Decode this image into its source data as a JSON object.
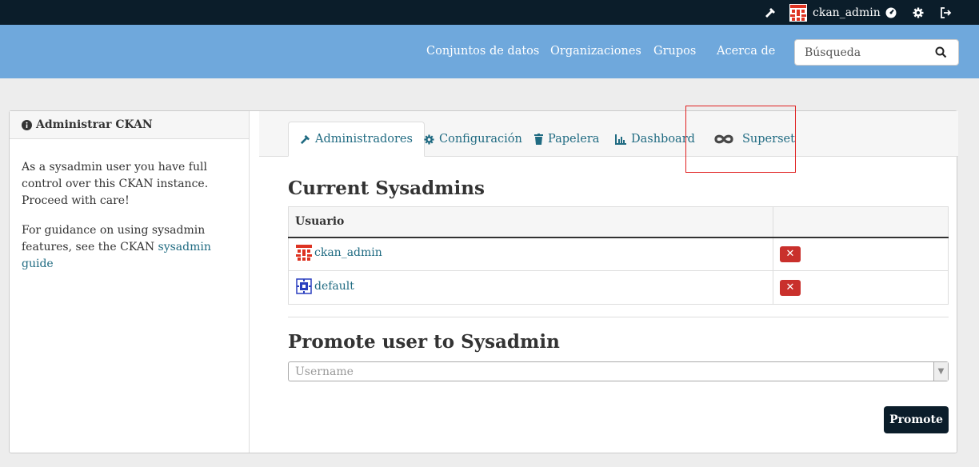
{
  "topbar": {
    "username": "ckan_admin"
  },
  "nav": {
    "datasets": "Conjuntos de datos",
    "organizations": "Organizaciones",
    "groups": "Grupos",
    "about": "Acerca de"
  },
  "search": {
    "placeholder": "Búsqueda"
  },
  "sidebar": {
    "title": "Administrar CKAN",
    "paragraph1": "As a sysadmin user you have full control over this CKAN instance. Proceed with care!",
    "paragraph2_prefix": "For guidance on using sysadmin features, see the CKAN",
    "guide_link": "sysadmin guide"
  },
  "tabs": [
    {
      "label": "Administradores"
    },
    {
      "label": "Configuración"
    },
    {
      "label": "Papelera"
    },
    {
      "label": "Dashboard"
    },
    {
      "label": "Superset"
    }
  ],
  "current": {
    "heading": "Current Sysadmins",
    "column_user": "Usuario",
    "rows": [
      {
        "name": "ckan_admin"
      },
      {
        "name": "default"
      }
    ]
  },
  "promote": {
    "heading": "Promote user to Sysadmin",
    "placeholder": "Username",
    "button": "Promote"
  },
  "colors": {
    "topbar": "#0b1d2a",
    "masthead": "#6fa8dc",
    "link": "#206b82",
    "danger": "#c9302c"
  }
}
